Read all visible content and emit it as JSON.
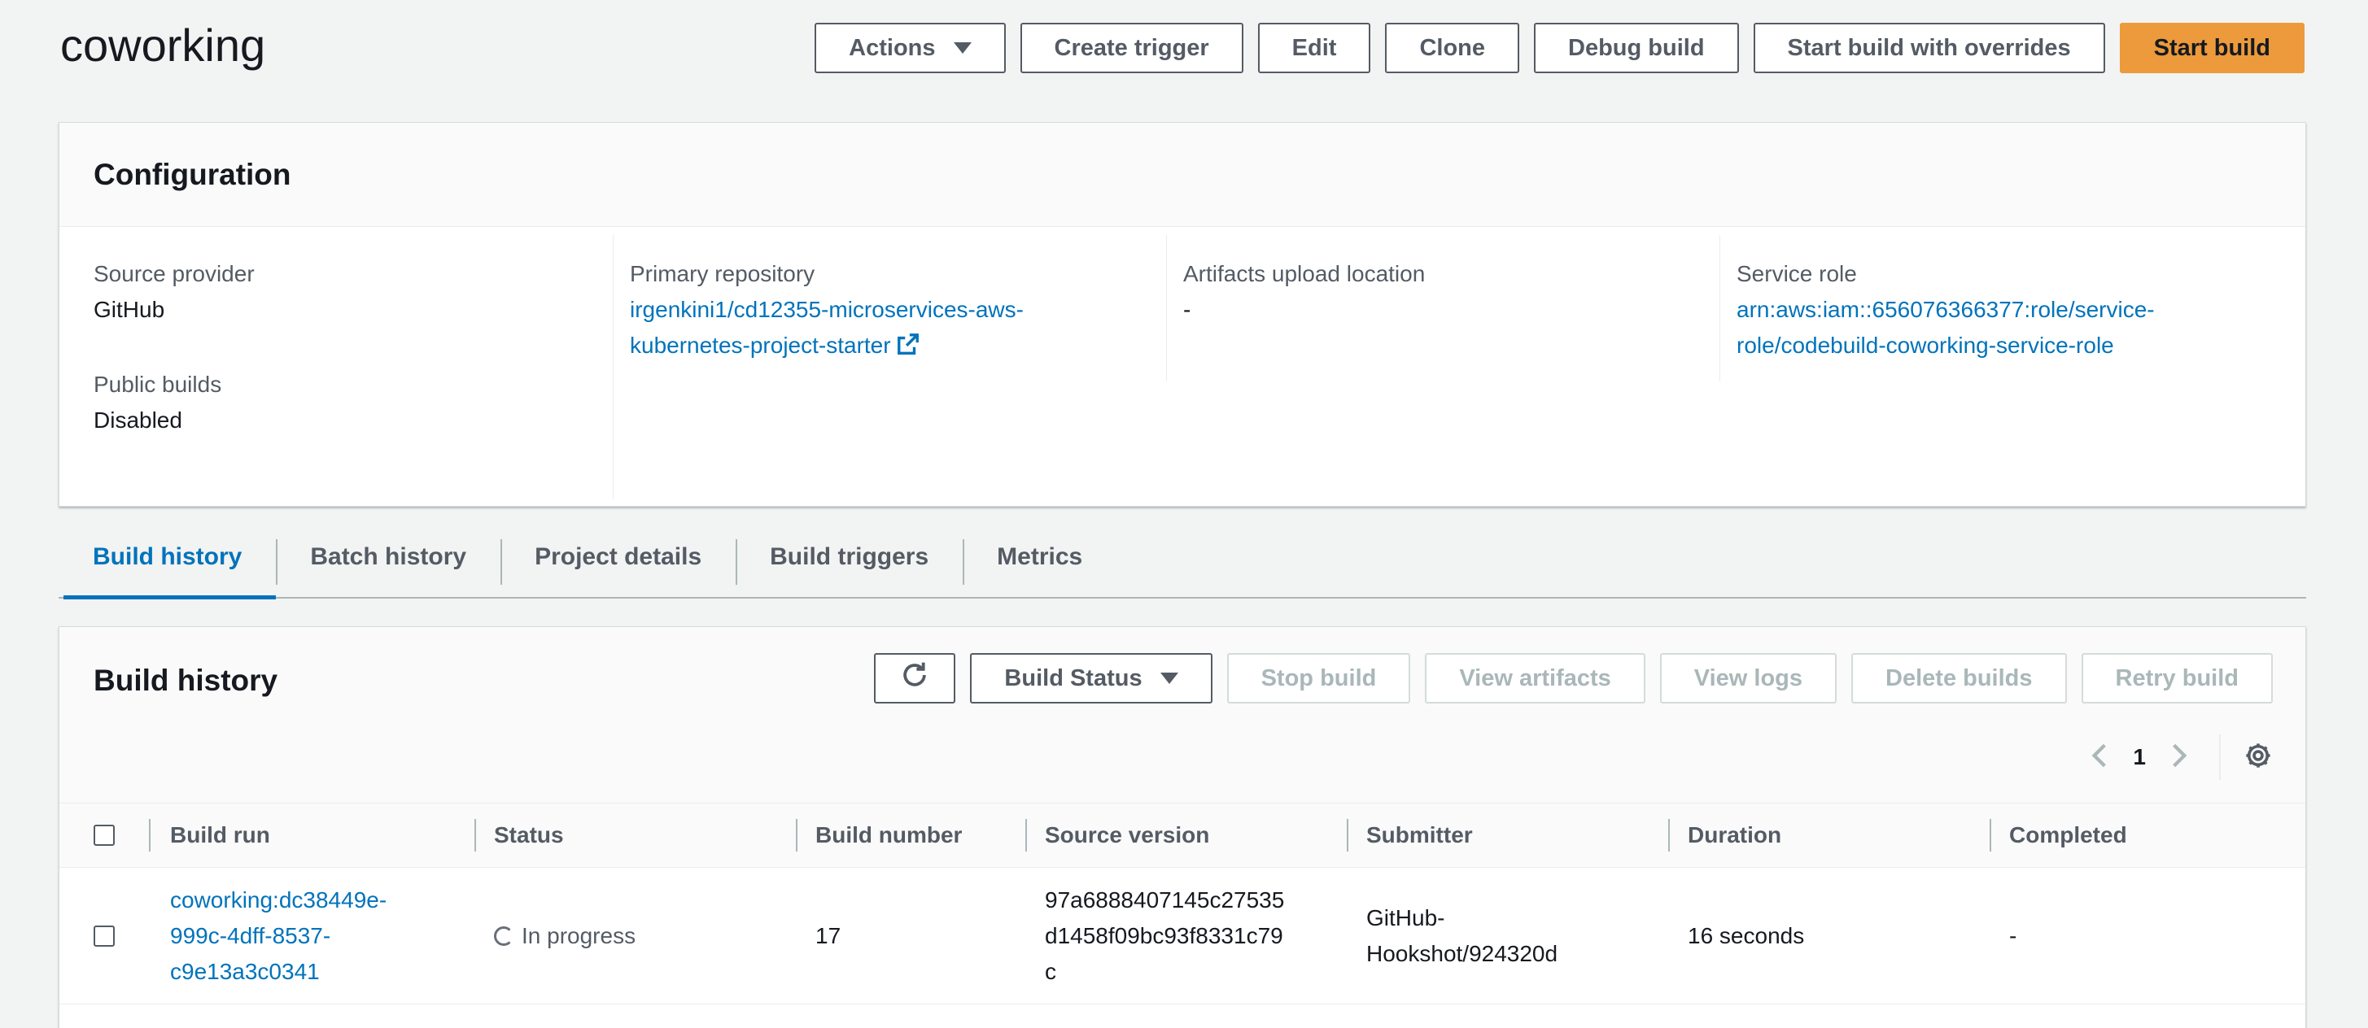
{
  "header": {
    "title": "coworking",
    "buttons": {
      "actions": "Actions",
      "create_trigger": "Create trigger",
      "edit": "Edit",
      "clone": "Clone",
      "debug_build": "Debug build",
      "start_with_overrides": "Start build with overrides",
      "start_build": "Start build"
    }
  },
  "configuration": {
    "title": "Configuration",
    "source_provider": {
      "label": "Source provider",
      "value": "GitHub"
    },
    "public_builds": {
      "label": "Public builds",
      "value": "Disabled"
    },
    "primary_repository": {
      "label": "Primary repository",
      "line1": "irgenkini1/cd12355-microservices-aws-",
      "line2": "kubernetes-project-starter"
    },
    "artifacts": {
      "label": "Artifacts upload location",
      "value": "-"
    },
    "service_role": {
      "label": "Service role",
      "line1": "arn:aws:iam::656076366377:role/service-",
      "line2": "role/codebuild-coworking-service-role"
    }
  },
  "tabs": [
    {
      "label": "Build history",
      "active": true
    },
    {
      "label": "Batch history",
      "active": false
    },
    {
      "label": "Project details",
      "active": false
    },
    {
      "label": "Build triggers",
      "active": false
    },
    {
      "label": "Metrics",
      "active": false
    }
  ],
  "build_history": {
    "title": "Build history",
    "buttons": {
      "build_status": "Build Status",
      "stop_build": "Stop build",
      "view_artifacts": "View artifacts",
      "view_logs": "View logs",
      "delete_builds": "Delete builds",
      "retry_build": "Retry build"
    },
    "page": "1",
    "columns": [
      "Build run",
      "Status",
      "Build number",
      "Source version",
      "Submitter",
      "Duration",
      "Completed"
    ],
    "rows": [
      {
        "build_run": [
          "coworking:dc38449e-",
          "999c-4dff-8537-",
          "c9e13a3c0341"
        ],
        "status": "In progress",
        "build_number": "17",
        "source_version": [
          "97a6888407145c27535",
          "d1458f09bc93f8331c79",
          "c"
        ],
        "submitter": [
          "GitHub-",
          "Hookshot/924320d"
        ],
        "duration": "16 seconds",
        "completed": "-"
      }
    ]
  },
  "colors": {
    "accent_link": "#0073bb",
    "primary_button": "#ec9a3c",
    "background": "#f2f3f3"
  }
}
